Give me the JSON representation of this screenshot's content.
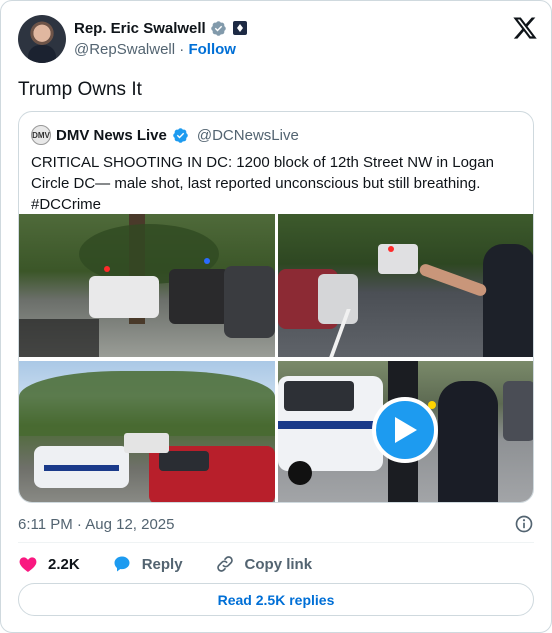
{
  "author": {
    "display_name": "Rep. Eric Swalwell",
    "handle": "@RepSwalwell",
    "separator": "·",
    "follow_label": "Follow"
  },
  "tweet": {
    "text": "Trump Owns It",
    "timestamp": "6:11 PM · Aug 12, 2025"
  },
  "quoted": {
    "avatar_text": "DMV",
    "display_name": "DMV News Live",
    "handle": "@DCNewsLive",
    "text": "CRITICAL SHOOTING IN DC: 1200 block of 12th Street NW in Logan Circle DC— male shot, last reported unconscious but still breathing. #DCCrime"
  },
  "actions": {
    "like_count": "2.2K",
    "reply_label": "Reply",
    "copy_label": "Copy link"
  },
  "read_replies_label": "Read 2.5K replies",
  "colors": {
    "link": "#006fd6",
    "verified": "#1d9bf0",
    "like": "#f91880",
    "border": "#cfd9de",
    "muted": "#536471"
  },
  "icons": {
    "verified": "verified-badge-icon",
    "gov": "government-label-icon",
    "x_logo": "x-logo-icon",
    "play": "play-icon",
    "info": "info-icon",
    "like": "heart-icon",
    "reply": "speech-bubble-icon",
    "copy": "link-icon"
  }
}
